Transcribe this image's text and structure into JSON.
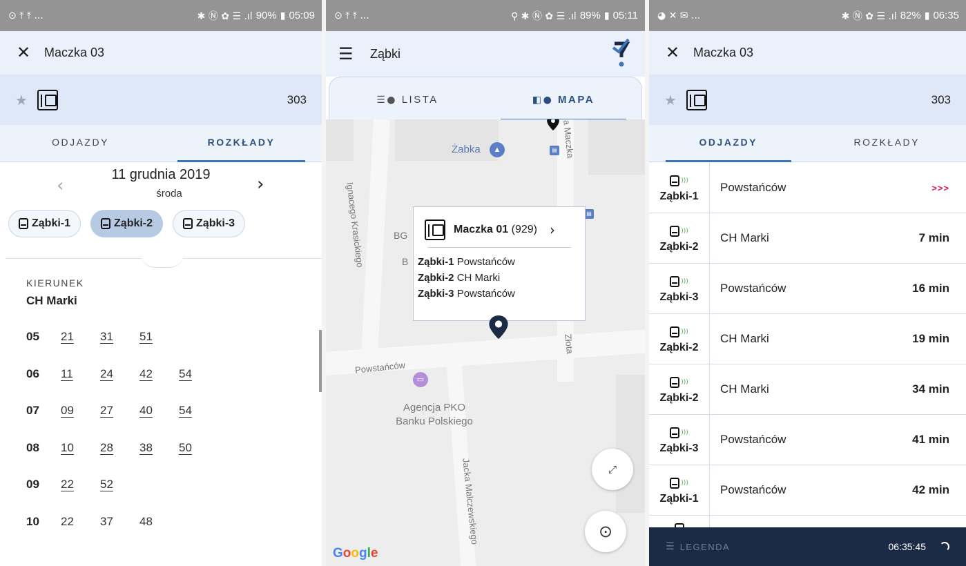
{
  "screens": [
    {
      "status": {
        "left": "⊙ ⤒ ⤒ ...",
        "right_icons": "✱ Ⓝ ✿ ☰ .ıl",
        "battery": "90%",
        "time": "05:09"
      },
      "header": {
        "title": "Maczka 03"
      },
      "stop_bar": {
        "number": "303"
      },
      "tabs": [
        "ODJAZDY",
        "ROZKŁADY"
      ],
      "active_tab": 1,
      "date": {
        "main": "11 grudnia 2019",
        "weekday": "środa"
      },
      "line_chips": [
        "Ząbki-1",
        "Ząbki-2",
        "Ząbki-3"
      ],
      "selected_chip": 1,
      "direction": {
        "label": "KIERUNEK",
        "value": "CH Marki"
      },
      "timetable": [
        {
          "hour": "05",
          "minutes": [
            "21",
            "31",
            "51"
          ]
        },
        {
          "hour": "06",
          "minutes": [
            "11",
            "24",
            "42",
            "54"
          ]
        },
        {
          "hour": "07",
          "minutes": [
            "09",
            "27",
            "40",
            "54"
          ]
        },
        {
          "hour": "08",
          "minutes": [
            "10",
            "28",
            "38",
            "50"
          ]
        },
        {
          "hour": "09",
          "minutes": [
            "22",
            "52"
          ]
        },
        {
          "hour": "10",
          "minutes": [
            "22",
            "37",
            "48"
          ]
        }
      ]
    },
    {
      "status": {
        "left": "⊙ ⤒ ⤒ ...",
        "right_icons": "⚲ ✱ Ⓝ ✿ ☰ .ıl",
        "battery": "89%",
        "time": "05:11"
      },
      "header": {
        "title": "Ząbki"
      },
      "tabs": [
        "LISTA",
        "MAPA"
      ],
      "active_tab": 1,
      "map": {
        "streets": [
          "Ignacego Krasickiego",
          "Powstańców",
          "Jacka Malczewskiego",
          "Złota",
          "a Maczka"
        ],
        "pois": {
          "zabka": "Żabka",
          "bank_line1": "Agencja PKO",
          "bank_line2": "Banku Polskiego",
          "bg": "BG",
          "by": "B"
        },
        "popup": {
          "stop_name": "Maczka 01",
          "stop_code": "(929)",
          "lines": [
            {
              "line": "Ząbki-1",
              "dest": "Powstańców"
            },
            {
              "line": "Ząbki-2",
              "dest": "CH Marki"
            },
            {
              "line": "Ząbki-3",
              "dest": "Powstańców"
            }
          ]
        },
        "attribution": {
          "g1": "G",
          "o1": "o",
          "o2": "o",
          "g2": "g",
          "l": "l",
          "e": "e"
        }
      }
    },
    {
      "status": {
        "left": "◕ ✕ ✉ ...",
        "right_icons": "✱ Ⓝ ✿ ☰ .ıl",
        "battery": "82%",
        "time": "06:35"
      },
      "header": {
        "title": "Maczka 03"
      },
      "stop_bar": {
        "number": "303"
      },
      "tabs": [
        "ODJAZDY",
        "ROZKŁADY"
      ],
      "active_tab": 0,
      "departures": [
        {
          "line": "Ząbki-1",
          "dest": "Powstańców",
          "time": ">>>"
        },
        {
          "line": "Ząbki-2",
          "dest": "CH Marki",
          "time": "7 min"
        },
        {
          "line": "Ząbki-3",
          "dest": "Powstańców",
          "time": "16 min"
        },
        {
          "line": "Ząbki-2",
          "dest": "CH Marki",
          "time": "19 min"
        },
        {
          "line": "Ząbki-2",
          "dest": "CH Marki",
          "time": "34 min"
        },
        {
          "line": "Ząbki-3",
          "dest": "Powstańców",
          "time": "41 min"
        },
        {
          "line": "Ząbki-1",
          "dest": "Powstańców",
          "time": "42 min"
        }
      ],
      "footer": {
        "legend": "LEGENDA",
        "clock": "06:35:45"
      }
    }
  ]
}
